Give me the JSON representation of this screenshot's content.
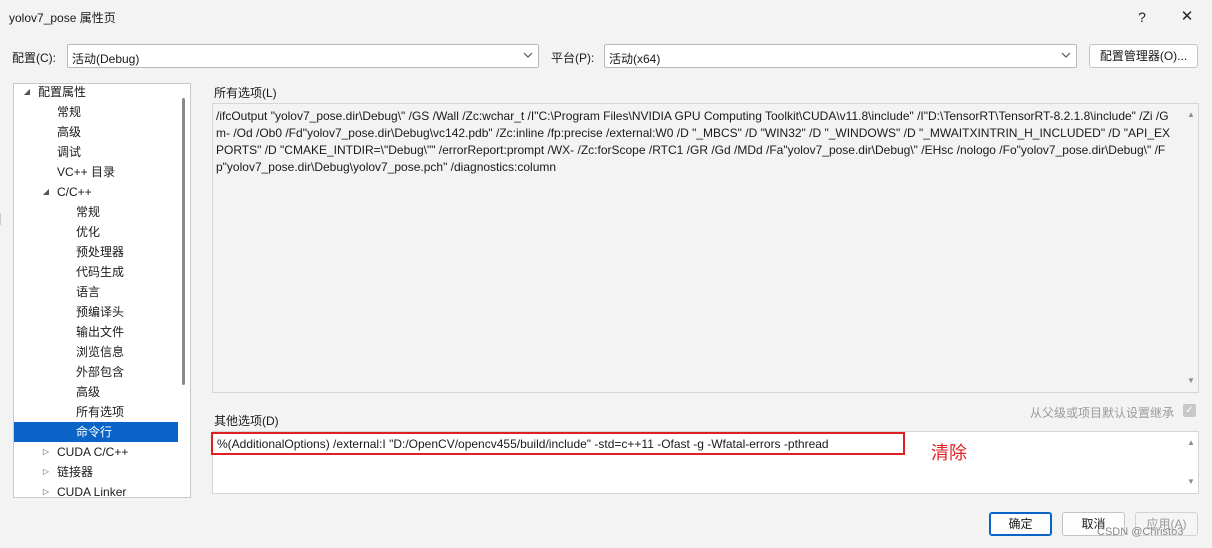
{
  "window": {
    "title": "yolov7_pose 属性页",
    "help_glyph": "?",
    "close_glyph": "✕"
  },
  "config_row": {
    "config_label": "配置(C):",
    "config_value": "活动(Debug)",
    "platform_label": "平台(P):",
    "platform_value": "活动(x64)",
    "config_manager_label": "配置管理器(O)..."
  },
  "tree": {
    "items": [
      {
        "label": "配置属性",
        "expander": "◢"
      },
      {
        "label": "常规",
        "expander": ""
      },
      {
        "label": "高级",
        "expander": ""
      },
      {
        "label": "调试",
        "expander": ""
      },
      {
        "label": "VC++ 目录",
        "expander": ""
      },
      {
        "label": "C/C++",
        "expander": "◢"
      },
      {
        "label": "常规",
        "expander": ""
      },
      {
        "label": "优化",
        "expander": ""
      },
      {
        "label": "预处理器",
        "expander": ""
      },
      {
        "label": "代码生成",
        "expander": ""
      },
      {
        "label": "语言",
        "expander": ""
      },
      {
        "label": "预编译头",
        "expander": ""
      },
      {
        "label": "输出文件",
        "expander": ""
      },
      {
        "label": "浏览信息",
        "expander": ""
      },
      {
        "label": "外部包含",
        "expander": ""
      },
      {
        "label": "高级",
        "expander": ""
      },
      {
        "label": "所有选项",
        "expander": ""
      },
      {
        "label": "命令行",
        "expander": ""
      },
      {
        "label": "CUDA C/C++",
        "expander": "▷"
      },
      {
        "label": "链接器",
        "expander": "▷"
      },
      {
        "label": "CUDA Linker",
        "expander": "▷"
      }
    ],
    "selected_label": "命令行"
  },
  "all_options": {
    "label": "所有选项(L)",
    "text": "/ifcOutput \"yolov7_pose.dir\\Debug\\\" /GS /Wall /Zc:wchar_t /I\"C:\\Program Files\\NVIDIA GPU Computing Toolkit\\CUDA\\v11.8\\include\" /I\"D:\\TensorRT\\TensorRT-8.2.1.8\\include\" /Zi /Gm- /Od /Ob0 /Fd\"yolov7_pose.dir\\Debug\\vc142.pdb\" /Zc:inline /fp:precise /external:W0 /D \"_MBCS\" /D \"WIN32\" /D \"_WINDOWS\" /D \"_MWAITXINTRIN_H_INCLUDED\" /D \"API_EXPORTS\" /D \"CMAKE_INTDIR=\\\"Debug\\\"\" /errorReport:prompt /WX- /Zc:forScope /RTC1 /GR /Gd /MDd /Fa\"yolov7_pose.dir\\Debug\\\" /EHsc /nologo /Fo\"yolov7_pose.dir\\Debug\\\" /Fp\"yolov7_pose.dir\\Debug\\yolov7_pose.pch\" /diagnostics:column"
  },
  "other_options": {
    "label": "其他选项(D)",
    "text": "%(AdditionalOptions) /external:I \"D:/OpenCV/opencv455/build/include\" -std=c++11 -Ofast -g -Wfatal-errors -pthread",
    "annotation": "清除",
    "inherit_label": "从父级或项目默认设置继承",
    "inherit_checked_glyph": "✓"
  },
  "buttons": {
    "ok": "确定",
    "cancel": "取消",
    "apply": "应用(A)"
  },
  "watermark": "CSDN @Christo3",
  "colors": {
    "selection": "#0a64c8",
    "annotation_red": "#e02020"
  }
}
